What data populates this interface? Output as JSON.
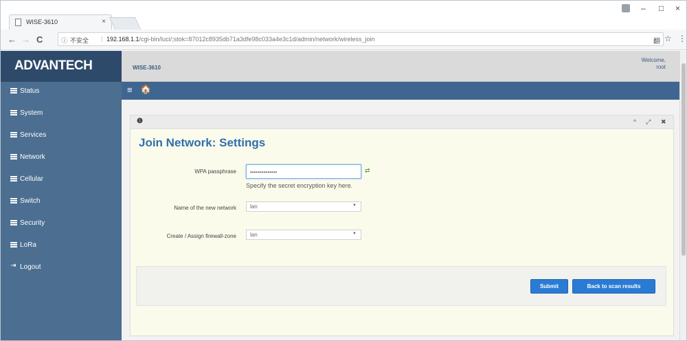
{
  "browser": {
    "tab_title": "WISE-3610",
    "tab_close": "×",
    "win_minimize": "–",
    "win_maximize": "□",
    "win_close": "×",
    "back": "←",
    "forward": "→",
    "reload": "C",
    "info": "ⓘ",
    "insecure_label": "不安全",
    "separator": "|",
    "url_host": "192.168.1.1",
    "url_path": "/cgi-bin/luci/;stok=87012c8935db71a3dfe98c033a4e3c1d/admin/network/wireless_join",
    "translate": "翻",
    "bookmark": "☆",
    "menu": "⋮"
  },
  "header": {
    "logo": "ADVANTECH",
    "device_name": "WISE-3610",
    "welcome_line1": "Welcome,",
    "welcome_line2": "root"
  },
  "sidebar": {
    "items": [
      {
        "label": "Status"
      },
      {
        "label": "System"
      },
      {
        "label": "Services"
      },
      {
        "label": "Network"
      },
      {
        "label": "Cellular"
      },
      {
        "label": "Switch"
      },
      {
        "label": "Security"
      },
      {
        "label": "LoRa"
      },
      {
        "label": "Logout"
      }
    ]
  },
  "topnav": {
    "menu_icon": "≡",
    "home_icon": "🏠"
  },
  "panel": {
    "info_icon": "❶",
    "collapse": "^",
    "expand": "⤢",
    "close": "✖",
    "title": "Join Network: Settings",
    "wpa_label": "WPA passphrase",
    "wpa_value": "••••••••••••••",
    "reveal_icon": "⇄",
    "wpa_hint": "Specify the secret encryption key here.",
    "network_label": "Name of the new network",
    "network_value": "lan",
    "firewall_label": "Create / Assign firewall-zone",
    "firewall_value": "lan",
    "caret": "▼",
    "submit": "Submit",
    "back_to_scan": "Back to scan results"
  }
}
